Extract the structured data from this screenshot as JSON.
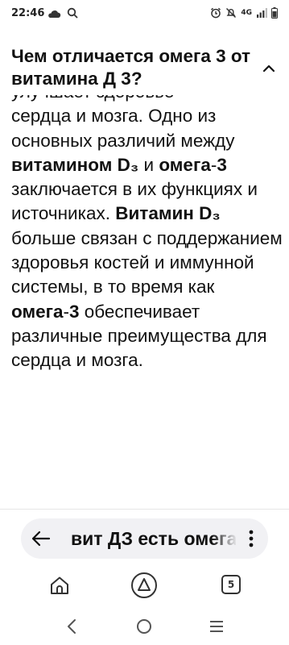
{
  "status_bar": {
    "time": "22:46",
    "network": "4G"
  },
  "header": {
    "title": "Чем отличается омега 3 от витамина Д 3?"
  },
  "answer": {
    "partial_top": "улучшает здоровье",
    "text_1": "сердца и мозга. Одно из основных различий между ",
    "bold_1": "витамином D₃",
    "text_2": " и ",
    "bold_2": "омега",
    "text_3": "-",
    "bold_3": "3",
    "text_4": " заключается в их функциях и источниках. ",
    "bold_4": "Витамин D₃",
    "text_5": " больше связан с поддержанием здоровья костей и иммунной системы, в то время как ",
    "bold_5": "омега",
    "text_6": "-",
    "bold_6": "3",
    "text_7": " обеспечивает различные преимущества для сердца и мозга."
  },
  "search": {
    "query": "вит ДЗ есть омега"
  },
  "bottom_bar": {
    "tabs_count": "5"
  },
  "icons": {
    "status_left": [
      "cloud-icon",
      "search-icon"
    ],
    "status_right": [
      "alarm-icon",
      "mute-icon",
      "network-4g-icon",
      "signal-icon",
      "battery-icon"
    ],
    "header": "chevron-up-icon",
    "query_bar": [
      "arrow-left-icon",
      "more-vertical-icon"
    ],
    "app_bar": [
      "home-icon",
      "alice-assistant-icon",
      "tabs-icon"
    ],
    "nav_bar": [
      "nav-back-icon",
      "nav-home-icon",
      "nav-recents-icon"
    ]
  }
}
